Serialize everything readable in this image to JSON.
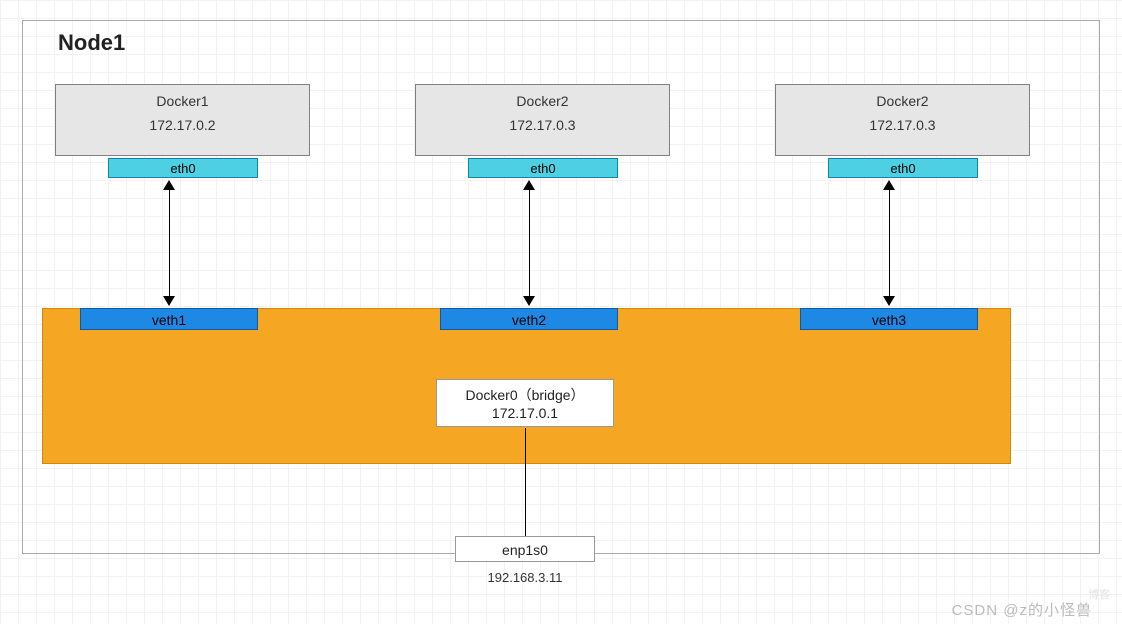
{
  "node_title": "Node1",
  "dockers": [
    {
      "name": "Docker1",
      "ip": "172.17.0.2",
      "port": "eth0",
      "veth": "veth1"
    },
    {
      "name": "Docker2",
      "ip": "172.17.0.3",
      "port": "eth0",
      "veth": "veth2"
    },
    {
      "name": "Docker2",
      "ip": "172.17.0.3",
      "port": "eth0",
      "veth": "veth3"
    }
  ],
  "bridge": {
    "label_line1": "Docker0（bridge）",
    "label_line2": "172.17.0.1"
  },
  "host_nic": {
    "name": "enp1s0",
    "ip": "192.168.3.11"
  },
  "watermark_csdn": "CSDN @z的小怪兽",
  "watermark_faint": "博客",
  "columns_x": [
    55,
    415,
    775
  ],
  "colors": {
    "docker_bg": "#e6e6e6",
    "eth_bg": "#4dd0e1",
    "veth_bg": "#1e88e5",
    "bridge_bg": "#f5a623"
  }
}
